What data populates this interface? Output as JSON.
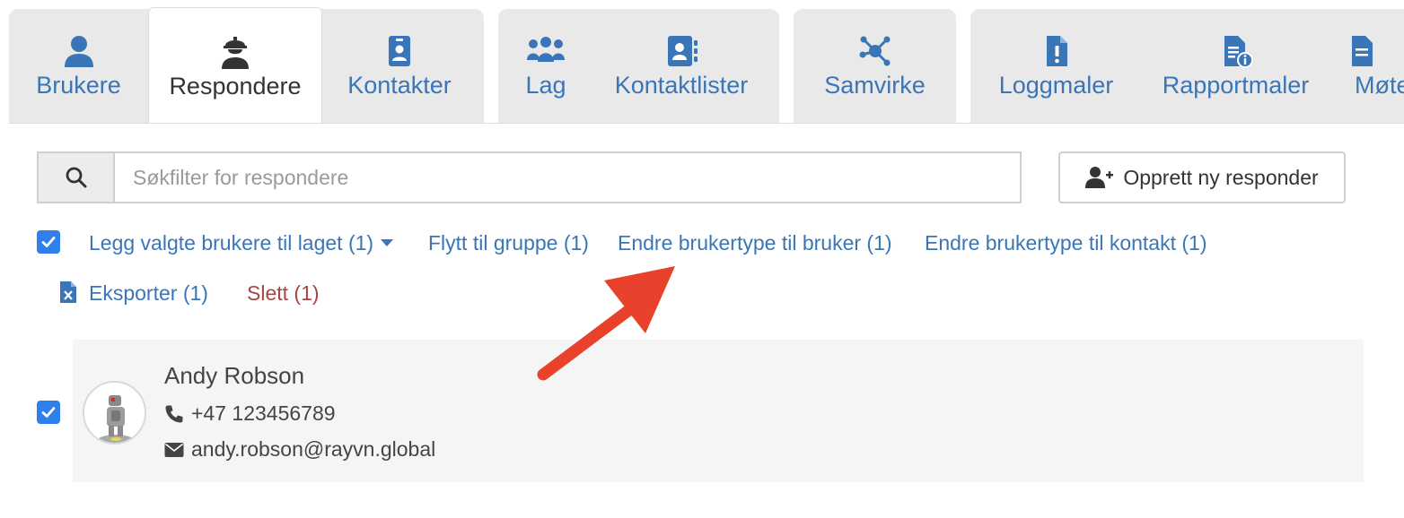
{
  "tabs": {
    "brukere": "Brukere",
    "respondere": "Respondere",
    "kontakter": "Kontakter",
    "lag": "Lag",
    "kontaktlister": "Kontaktlister",
    "samvirke": "Samvirke",
    "loggmaler": "Loggmaler",
    "rapportmaler": "Rapportmaler",
    "mote": "Møte"
  },
  "search": {
    "placeholder": "Søkfilter for respondere"
  },
  "create_button": {
    "label": "Opprett ny responder"
  },
  "actions": {
    "add_to_team": "Legg valgte brukere til laget (1)",
    "move_to_group": "Flytt til gruppe (1)",
    "change_to_user": "Endre brukertype til bruker (1)",
    "change_to_contact": "Endre brukertype til kontakt (1)",
    "export": "Eksporter (1)",
    "delete": "Slett (1)"
  },
  "responder": {
    "name": "Andy Robson",
    "phone": "+47 123456789",
    "email": "andy.robson@rayvn.global"
  },
  "colors": {
    "link": "#3a76b7",
    "danger": "#a94442",
    "checkbox": "#2f80ed",
    "annotation_arrow": "#e8412c"
  }
}
